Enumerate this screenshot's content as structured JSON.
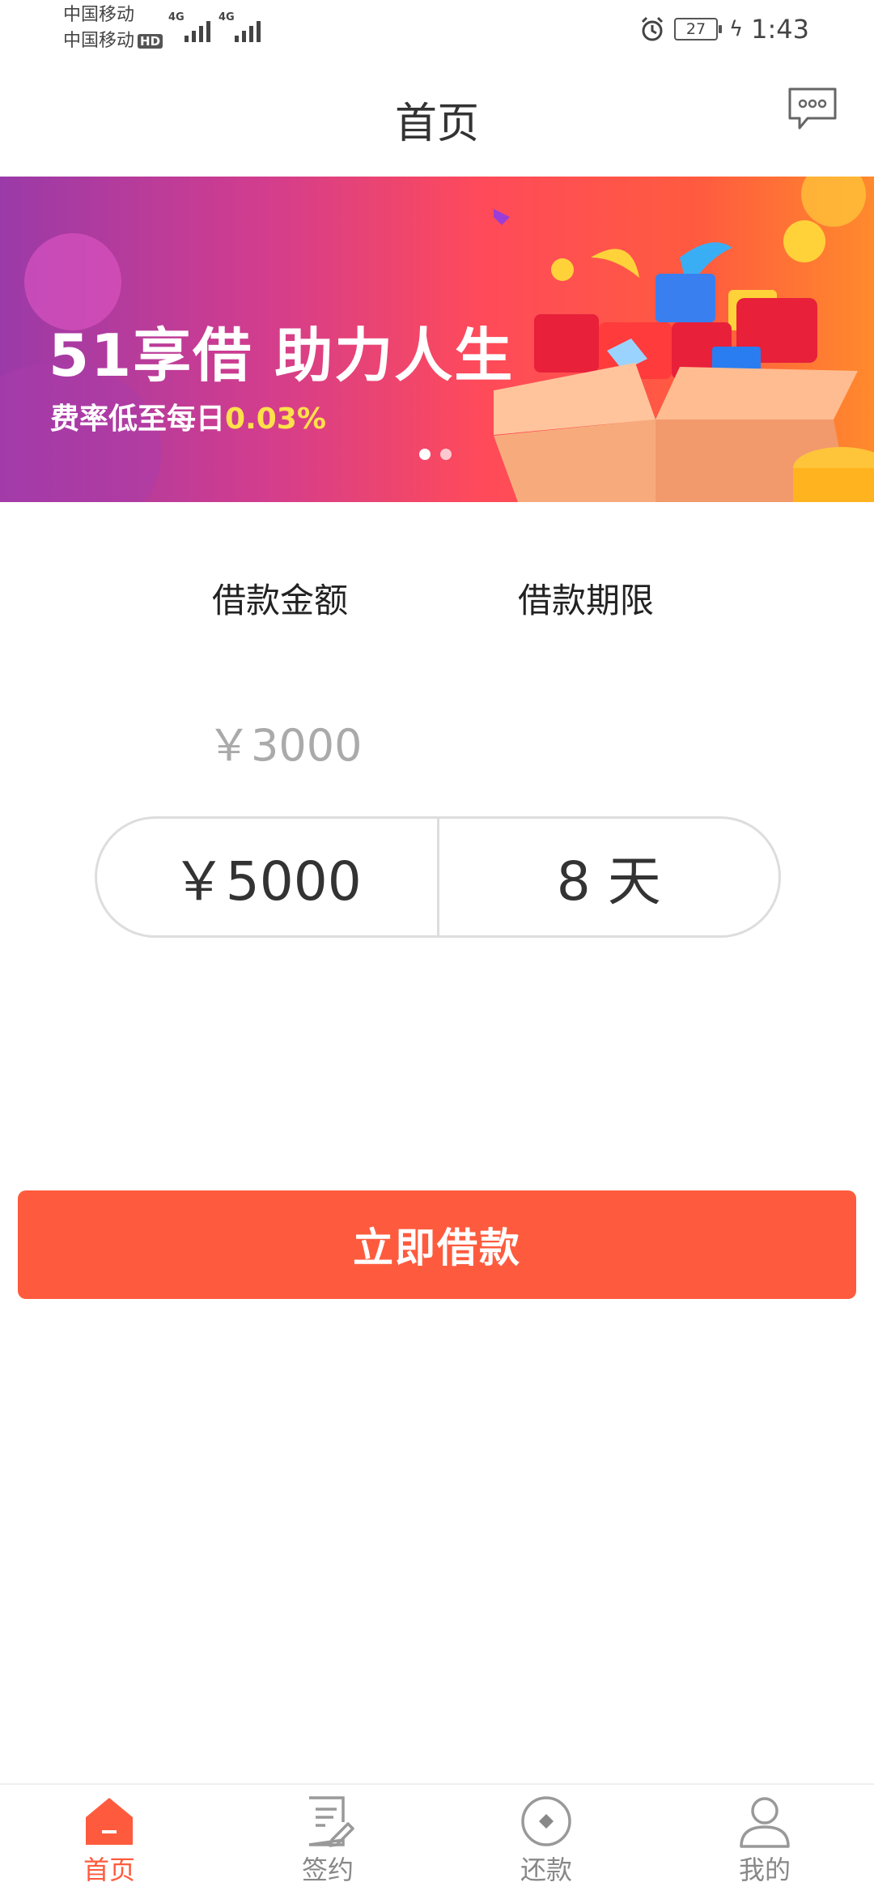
{
  "status_bar": {
    "carrier1": "中国移动",
    "carrier2": "中国移动",
    "hd": "HD",
    "network1": "4G",
    "network2": "4G",
    "battery": "27",
    "time": "1:43"
  },
  "header": {
    "title": "首页",
    "message_icon": "chat-bubble-icon"
  },
  "banner": {
    "title": "51享借 助力人生",
    "subtitle_prefix": "费率低至每日",
    "subtitle_rate": "0.03%",
    "slide_count": 2,
    "active_slide": 1
  },
  "loan": {
    "amount_label": "借款金额",
    "term_label": "借款期限",
    "amount_option_above": "￥3000",
    "amount_selected": "￥5000",
    "term_selected": "8 天"
  },
  "action": {
    "borrow_label": "立即借款"
  },
  "tabbar": [
    {
      "label": "首页",
      "icon": "home-icon",
      "active": true
    },
    {
      "label": "签约",
      "icon": "contract-icon",
      "active": false
    },
    {
      "label": "还款",
      "icon": "repay-icon",
      "active": false
    },
    {
      "label": "我的",
      "icon": "user-icon",
      "active": false
    }
  ],
  "colors": {
    "accent": "#fe5b3e",
    "banner_highlight": "#ffe14a",
    "text": "#333333",
    "muted": "#aaaaaa"
  }
}
